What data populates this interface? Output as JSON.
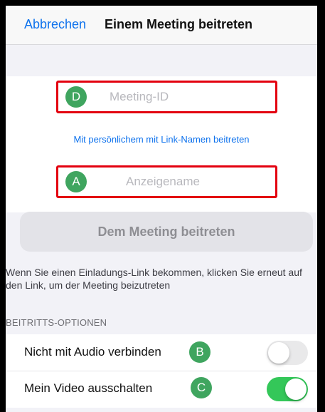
{
  "navbar": {
    "cancel_label": "Abbrechen",
    "title": "Einem Meeting beitreten"
  },
  "meeting_id": {
    "badge": "D",
    "placeholder": "Meeting-ID"
  },
  "personal_link_label": "Mit persönlichem mit Link-Namen beitreten",
  "display_name": {
    "badge": "A",
    "placeholder": "Anzeigename"
  },
  "join_button_label": "Dem Meeting beitreten",
  "help_text": "Wenn Sie einen Einladungs-Link bekommen, klicken Sie erneut auf den Link, um der Meeting beizutreten",
  "options": {
    "header": "BEITRITTS-OPTIONEN",
    "items": [
      {
        "label": "Nicht mit Audio verbinden",
        "badge": "B",
        "enabled": false
      },
      {
        "label": "Mein Video ausschalten",
        "badge": "C",
        "enabled": true
      }
    ]
  },
  "colors": {
    "accent_blue": "#0e72ed",
    "highlight_red": "#e3000f",
    "badge_green": "#3fa55f",
    "toggle_on_green": "#34c759"
  }
}
